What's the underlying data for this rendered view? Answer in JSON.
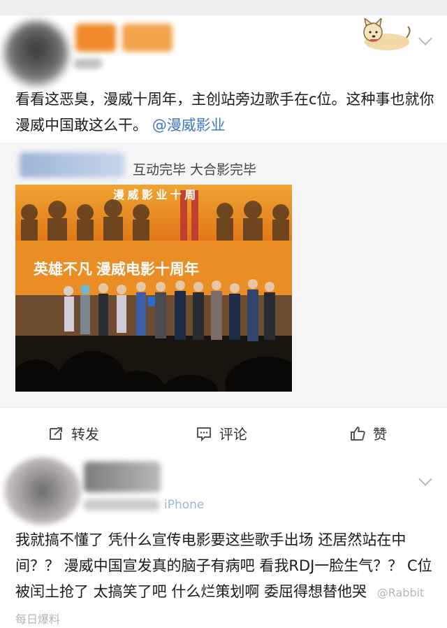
{
  "post": {
    "text": "看看这恶臭，漫威十周年，主创站旁边歌手在c位。这种事也就你漫威中国敢这么干。",
    "mention": "@漫威影业",
    "repost_header": "互动完毕 大合影完毕",
    "photo": {
      "banner_top": "漫 威 影 业 十 周",
      "banner_main": "英雄不凡  漫威电影十周年",
      "colors": {
        "stage": "#f0a432",
        "banner": "#e98b20",
        "text": "#ffffff",
        "floor": "#1a140f"
      }
    }
  },
  "actions": {
    "repost": "转发",
    "comment": "评论",
    "like": "赞"
  },
  "comment": {
    "device": "iPhone",
    "text": "我就搞不懂了 凭什么宣传电影要这些歌手出场 还居然站在中间？？ 漫威中国宣发真的脑子有病吧 看我RDJ一脸生气？？ C位被闰土抢了 太搞笑了吧 什么烂策划啊 委屈得想替他哭",
    "watermark": "@Rabbit每日爆料"
  },
  "colors": {
    "link": "#3d77c2",
    "bg": "#efeff2",
    "repost_bg": "#f5f5f7"
  }
}
